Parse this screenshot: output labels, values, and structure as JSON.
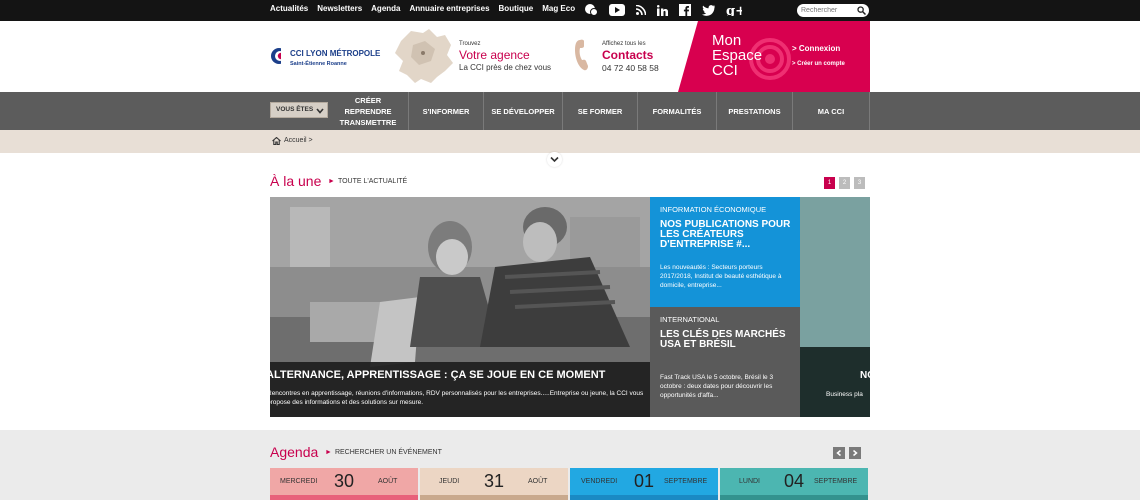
{
  "topbar": {
    "links": [
      "Actualités",
      "Newsletters",
      "Agenda",
      "Annuaire entreprises",
      "Boutique",
      "Mag Eco"
    ],
    "social_icons": [
      "chat-icon",
      "youtube-icon",
      "rss-icon",
      "linkedin-icon",
      "facebook-icon",
      "twitter-icon",
      "googleplus-icon"
    ],
    "search_placeholder": "Rechercher"
  },
  "header": {
    "logo_name": "CCI LYON MÉTROPOLE",
    "logo_sub": "Saint-Étienne Roanne",
    "agence_small": "Trouvez",
    "agence_big": "Votre agence",
    "agence_sub": "La CCI près de chez vous",
    "contacts_small": "Affichez tous les",
    "contacts_big": "Contacts",
    "contacts_phone": "04 72 40 58 58",
    "espace_title": "Mon Espace CCI",
    "connexion": "> Connexion",
    "creer_compte": "> Créer un compte"
  },
  "nav": {
    "vous_etes": "VOUS ÊTES",
    "items": [
      "CRÉER REPRENDRE TRANSMETTRE",
      "S'INFORMER",
      "SE DÉVELOPPER",
      "SE FORMER",
      "FORMALITÉS",
      "PRESTATIONS",
      "MA CCI"
    ]
  },
  "breadcrumb": {
    "home": "Accueil >"
  },
  "une": {
    "title": "À la une",
    "link": "TOUTE L'ACTUALITÉ",
    "pages": [
      "1",
      "2",
      "3"
    ],
    "hero_title": "ALTERNANCE, APPRENTISSAGE : ÇA SE JOUE EN CE MOMENT",
    "hero_text": "Rencontres en apprentissage, réunions d'informations, RDV personnalisés pour les entreprises.....Entreprise ou jeune, la CCI vous propose des informations et des solutions sur mesure.",
    "cards": [
      {
        "category": "INFORMATION ÉCONOMIQUE",
        "title": "NOS PUBLICATIONS POUR LES CRÉATEURS D'ENTREPRISE #...",
        "excerpt": "Les nouveautés : Secteurs porteurs 2017/2018, Institut de beauté esthétique à domicile, entreprise..."
      },
      {
        "category": "INTERNATIONAL",
        "title": "LES CLÉS DES MARCHÉS USA ET BRÉSIL",
        "excerpt": "Fast Track USA le 5 octobre, Brésil le 3 octobre : deux dates pour découvrir les opportunités d'affa..."
      },
      {
        "category": "",
        "title": "NO",
        "excerpt": "Business pla"
      }
    ]
  },
  "agenda": {
    "title": "Agenda",
    "link": "RECHERCHER UN ÉVÉNEMENT",
    "days": [
      {
        "day": "MERCREDI",
        "num": "30",
        "month": "AOÛT",
        "bg": "#f0a7a6",
        "strip": "#e8607a"
      },
      {
        "day": "JEUDI",
        "num": "31",
        "month": "AOÛT",
        "bg": "#ecd6c4",
        "strip": "#c9a98d"
      },
      {
        "day": "VENDREDI",
        "num": "01",
        "month": "SEPTEMBRE",
        "bg": "#22a8e2",
        "strip": "#1a8ac4"
      },
      {
        "day": "LUNDI",
        "num": "04",
        "month": "SEPTEMBRE",
        "bg": "#4cb6b1",
        "strip": "#33928e"
      }
    ]
  },
  "colors": {
    "accent": "#c8004d",
    "espace": "#d8004f",
    "nav": "#5c5c5c",
    "topbar": "#141414"
  }
}
